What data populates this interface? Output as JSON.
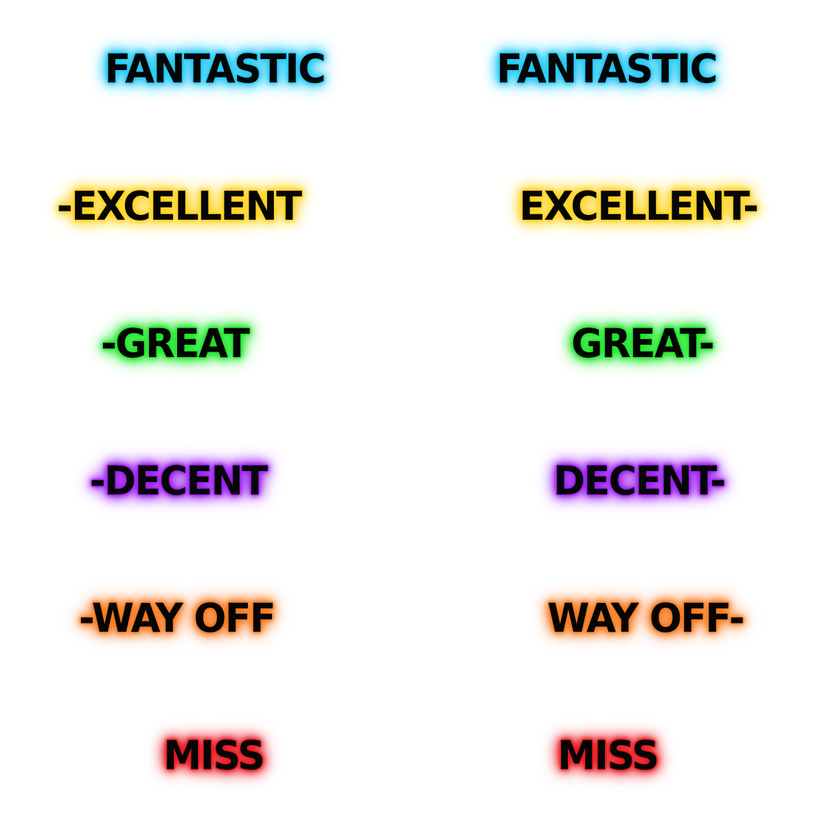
{
  "sheet": {
    "left_column": [
      {
        "id": "fantastic",
        "text": "FANTASTIC",
        "glow": "#23c8f5"
      },
      {
        "id": "excellent",
        "text": "-EXCELLENT",
        "glow": "#ffd21e"
      },
      {
        "id": "great",
        "text": "-GREAT",
        "glow": "#1ee62a"
      },
      {
        "id": "decent",
        "text": "-DECENT",
        "glow": "#9b1ef0"
      },
      {
        "id": "wayoff",
        "text": "-WAY OFF",
        "glow": "#f5791e"
      },
      {
        "id": "miss",
        "text": "MISS",
        "glow": "#e8181e"
      }
    ],
    "right_column": [
      {
        "id": "fantastic",
        "text": "FANTASTIC",
        "glow": "#23c8f5"
      },
      {
        "id": "excellent",
        "text": "EXCELLENT-",
        "glow": "#ffd21e"
      },
      {
        "id": "great",
        "text": "GREAT-",
        "glow": "#1ee62a"
      },
      {
        "id": "decent",
        "text": "DECENT-",
        "glow": "#9b1ef0"
      },
      {
        "id": "wayoff",
        "text": "WAY OFF-",
        "glow": "#f5791e"
      },
      {
        "id": "miss",
        "text": "MISS",
        "glow": "#e8181e"
      }
    ]
  }
}
